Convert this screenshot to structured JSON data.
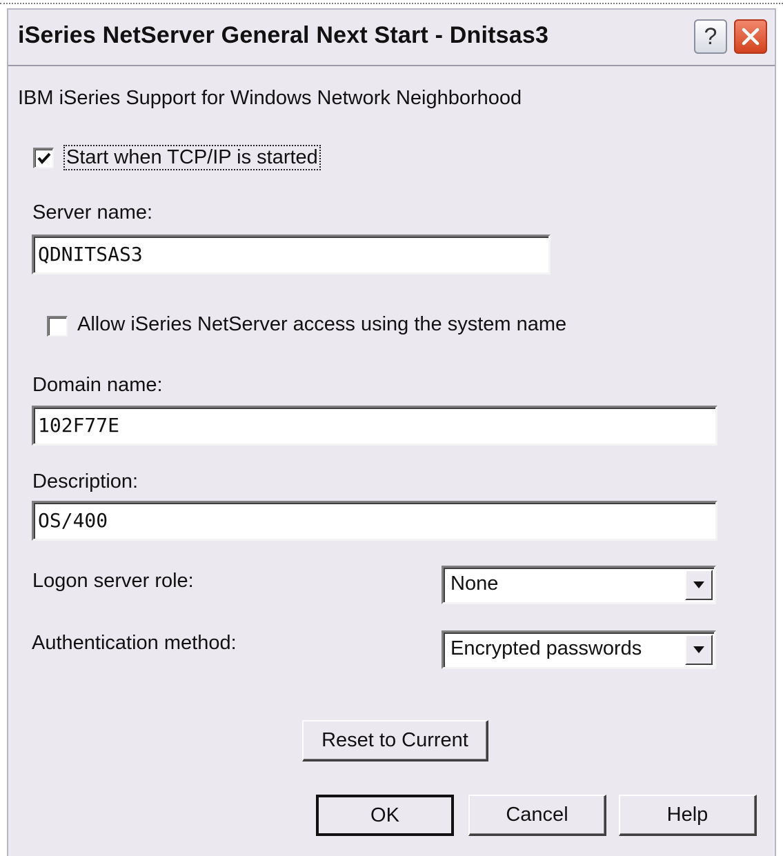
{
  "window": {
    "title": "iSeries NetServer General Next Start - Dnitsas3",
    "help_glyph": "?",
    "icons": {
      "help": "question-mark-icon",
      "close": "close-x-icon"
    },
    "colors": {
      "dialog_bg": "#ebe8ef",
      "close_button": "#d2431e"
    }
  },
  "form": {
    "subtitle": "IBM iSeries Support for Windows Network Neighborhood",
    "start_with_tcpip": {
      "label": "Start when TCP/IP is started",
      "checked": true
    },
    "server_name": {
      "label": "Server name:",
      "value": "QDNITSAS3"
    },
    "allow_system_name": {
      "label": "Allow iSeries NetServer access using the system name",
      "checked": false
    },
    "domain_name": {
      "label": "Domain name:",
      "value": "102F77E"
    },
    "description": {
      "label": "Description:",
      "value": "OS/400"
    },
    "logon_server_role": {
      "label": "Logon server role:",
      "selected": "None"
    },
    "authentication_method": {
      "label": "Authentication method:",
      "selected": "Encrypted passwords"
    }
  },
  "buttons": {
    "reset": "Reset to Current",
    "ok": "OK",
    "cancel": "Cancel",
    "help": "Help"
  }
}
